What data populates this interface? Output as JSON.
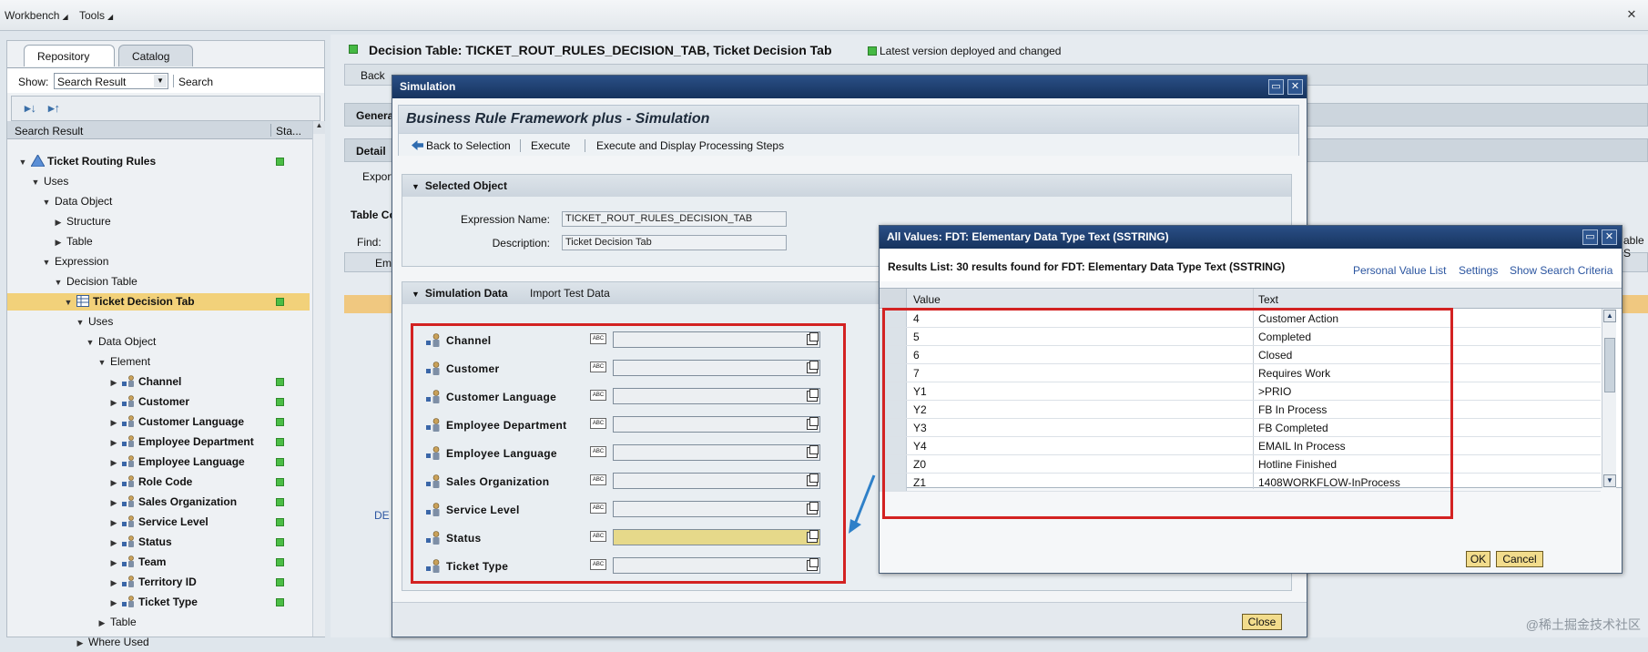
{
  "menu": {
    "workbench": "Workbench",
    "tools": "Tools"
  },
  "left": {
    "tabs": [
      "Repository",
      "Catalog"
    ],
    "show_label": "Show:",
    "show_value": "Search Result",
    "search_label": "Search",
    "col_search_result": "Search Result",
    "col_status": "Sta...",
    "tree": [
      {
        "label": "Ticket Routing Rules",
        "level": 0,
        "tw": "▼",
        "icon": "app-triangle-icon",
        "bold": true,
        "status": true
      },
      {
        "label": "Uses",
        "level": 1,
        "tw": "▼"
      },
      {
        "label": "Data Object",
        "level": 2,
        "tw": "▼"
      },
      {
        "label": "Structure",
        "level": 3,
        "tw": "▶"
      },
      {
        "label": "Table",
        "level": 3,
        "tw": "▶"
      },
      {
        "label": "Expression",
        "level": 2,
        "tw": "▼"
      },
      {
        "label": "Decision Table",
        "level": 3,
        "tw": "▼"
      },
      {
        "label": "Ticket Decision Tab",
        "level": 4,
        "tw": "▼",
        "icon": "decision-table-icon",
        "bold": true,
        "status": true,
        "selected": true
      },
      {
        "label": "Uses",
        "level": 5,
        "tw": "▼"
      },
      {
        "label": "Data Object",
        "level": 6,
        "tw": "▼"
      },
      {
        "label": "Element",
        "level": 7,
        "tw": "▼"
      },
      {
        "label": "Channel",
        "level": 8,
        "tw": "▶",
        "icon": "element-icon",
        "bold": true,
        "status": true
      },
      {
        "label": "Customer",
        "level": 8,
        "tw": "▶",
        "icon": "element-icon",
        "bold": true,
        "status": true
      },
      {
        "label": "Customer Language",
        "level": 8,
        "tw": "▶",
        "icon": "element-icon",
        "bold": true,
        "status": true
      },
      {
        "label": "Employee Department",
        "level": 8,
        "tw": "▶",
        "icon": "element-icon",
        "bold": true,
        "status": true
      },
      {
        "label": "Employee Language",
        "level": 8,
        "tw": "▶",
        "icon": "element-icon",
        "bold": true,
        "status": true
      },
      {
        "label": "Role Code",
        "level": 8,
        "tw": "▶",
        "icon": "element-icon",
        "bold": true,
        "status": true
      },
      {
        "label": "Sales Organization",
        "level": 8,
        "tw": "▶",
        "icon": "element-icon",
        "bold": true,
        "status": true
      },
      {
        "label": "Service Level",
        "level": 8,
        "tw": "▶",
        "icon": "element-icon",
        "bold": true,
        "status": true
      },
      {
        "label": "Status",
        "level": 8,
        "tw": "▶",
        "icon": "element-icon",
        "bold": true,
        "status": true
      },
      {
        "label": "Team",
        "level": 8,
        "tw": "▶",
        "icon": "element-icon",
        "bold": true,
        "status": true
      },
      {
        "label": "Territory ID",
        "level": 8,
        "tw": "▶",
        "icon": "element-icon",
        "bold": true,
        "status": true
      },
      {
        "label": "Ticket Type",
        "level": 8,
        "tw": "▶",
        "icon": "element-icon",
        "bold": true,
        "status": true
      },
      {
        "label": "Table",
        "level": 7,
        "tw": "▶"
      },
      {
        "label": "Where Used",
        "level": 5,
        "tw": "▶"
      }
    ]
  },
  "main": {
    "title": "Decision Table: TICKET_ROUT_RULES_DECISION_TAB, Ticket Decision Tab",
    "status_text": "Latest version deployed and changed",
    "bg": {
      "back": "Back",
      "general": "Genera",
      "detail": "Detail",
      "export": "Export",
      "table_c": "Table Co",
      "find": "Find:",
      "emp": "Emp",
      "de": "DE (",
      "able": "able S"
    }
  },
  "simulation": {
    "window_title": "Simulation",
    "header": "Business Rule Framework plus - Simulation",
    "tools": [
      "Back to Selection",
      "Execute",
      "Execute and Display Processing Steps"
    ],
    "selected_object": {
      "title": "Selected Object",
      "expr_label": "Expression Name:",
      "expr_value": "TICKET_ROUT_RULES_DECISION_TAB",
      "desc_label": "Description:",
      "desc_value": "Ticket Decision Tab"
    },
    "sim_data": {
      "title": "Simulation Data",
      "import": "Import Test Data",
      "fields": [
        "Channel",
        "Customer",
        "Customer Language",
        "Employee Department",
        "Employee Language",
        "Sales Organization",
        "Service Level",
        "Status",
        "Ticket Type"
      ],
      "highlighted": "Status"
    },
    "close": "Close"
  },
  "all_values": {
    "window_title": "All Values: FDT: Elementary Data Type Text (SSTRING)",
    "results": "Results List: 30 results found for FDT: Elementary Data Type Text (SSTRING)",
    "links": [
      "Personal Value List",
      "Settings",
      "Show Search Criteria"
    ],
    "col_value": "Value",
    "col_text": "Text",
    "rows": [
      {
        "value": "4",
        "text": "Customer Action"
      },
      {
        "value": "5",
        "text": "Completed"
      },
      {
        "value": "6",
        "text": "Closed"
      },
      {
        "value": "7",
        "text": "Requires Work"
      },
      {
        "value": "Y1",
        "text": ">PRIO"
      },
      {
        "value": "Y2",
        "text": "FB In Process"
      },
      {
        "value": "Y3",
        "text": "FB Completed"
      },
      {
        "value": "Y4",
        "text": "EMAIL In Process"
      },
      {
        "value": "Z0",
        "text": "Hotline Finished"
      },
      {
        "value": "Z1",
        "text": "1408WORKFLOW-InProcess"
      }
    ],
    "ok": "OK",
    "cancel": "Cancel"
  },
  "watermark": "@稀土掘金技术社区",
  "colors": {
    "status_green": "#45b944",
    "title_bar": "#1f3f72",
    "highlight": "#e6d98a",
    "red_box": "#d32222"
  }
}
